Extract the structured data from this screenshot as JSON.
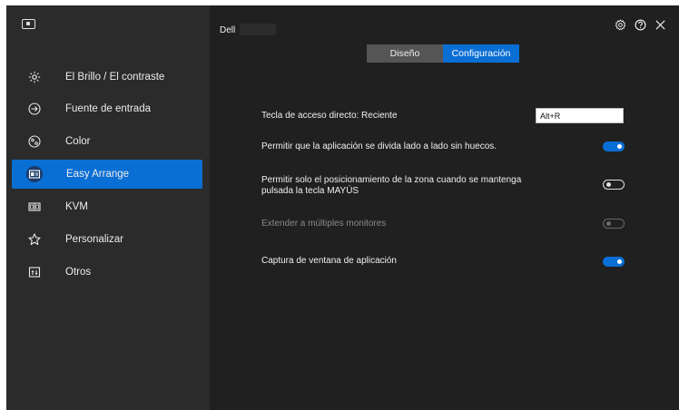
{
  "sidebar": {
    "items": [
      {
        "label": "El Brillo / El contraste",
        "icon": "brightness-icon",
        "active": false
      },
      {
        "label": "Fuente de entrada",
        "icon": "input-source-icon",
        "active": false
      },
      {
        "label": "Color",
        "icon": "color-icon",
        "active": false
      },
      {
        "label": "Easy Arrange",
        "icon": "easy-arrange-icon",
        "active": true
      },
      {
        "label": "KVM",
        "icon": "kvm-icon",
        "active": false
      },
      {
        "label": "Personalizar",
        "icon": "star-icon",
        "active": false
      },
      {
        "label": "Otros",
        "icon": "others-icon",
        "active": false
      }
    ]
  },
  "header": {
    "monitor_name": "Dell"
  },
  "tabs": [
    {
      "label": "Diseño",
      "active": false
    },
    {
      "label": "Configuración",
      "active": true
    }
  ],
  "settings": {
    "hotkey": {
      "label": "Tecla de acceso directo: Reciente",
      "value": "Alt+R"
    },
    "split_seamless": {
      "label": "Permitir que la aplicación se divida lado a lado sin huecos.",
      "enabled": true
    },
    "zone_shift": {
      "label_line1": "Permitir solo el posicionamiento de la zona cuando se mantenga",
      "label_line2": "pulsada la tecla MAYÚS",
      "enabled": false
    },
    "multi_monitor": {
      "label": "Extender a múltiples monitores",
      "enabled": false,
      "disabled": true
    },
    "window_capture": {
      "label": "Captura de ventana de aplicación",
      "enabled": true
    }
  },
  "colors": {
    "accent": "#0a6fd4",
    "sidebar_bg": "#2b2b2b",
    "main_bg": "#202020"
  }
}
